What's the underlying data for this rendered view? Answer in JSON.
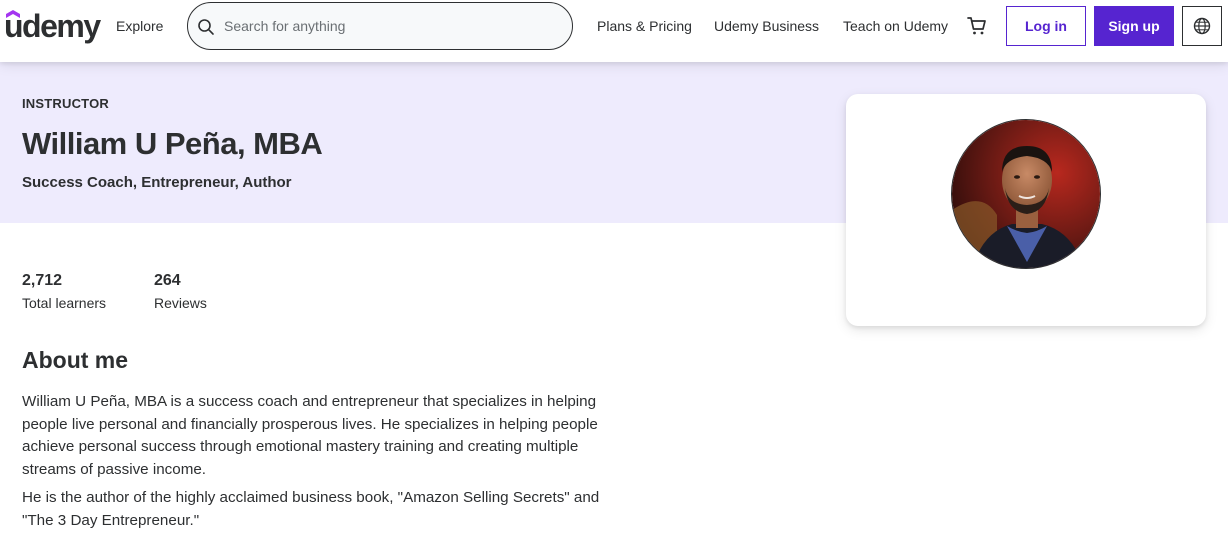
{
  "header": {
    "logo": "udemy",
    "explore": "Explore",
    "search": {
      "placeholder": "Search for anything",
      "value": ""
    },
    "nav": {
      "plans": "Plans & Pricing",
      "business": "Udemy Business",
      "teach": "Teach on Udemy"
    },
    "login_label": "Log in",
    "signup_label": "Sign up",
    "icons": {
      "search": "search-icon",
      "cart": "cart-icon",
      "language": "globe-icon"
    }
  },
  "instructor": {
    "eyebrow": "INSTRUCTOR",
    "name": "William U Peña, MBA",
    "headline": "Success Coach, Entrepreneur, Author"
  },
  "stats": [
    {
      "value": "2,712",
      "label": "Total learners"
    },
    {
      "value": "264",
      "label": "Reviews"
    }
  ],
  "about": {
    "title": "About me",
    "paragraphs": [
      "William U Peña, MBA is a success coach and entrepreneur that specializes in helping people live personal and financially prosperous lives. He specializes in helping people achieve personal success through emotional mastery training and creating multiple streams of passive income.",
      "He is the author of the highly acclaimed business book, \"Amazon Selling Secrets\" and \"The 3 Day Entrepreneur.\""
    ]
  },
  "colors": {
    "brand": "#5624d0",
    "hero_bg": "#eeebfd",
    "text": "#2d2f31"
  }
}
